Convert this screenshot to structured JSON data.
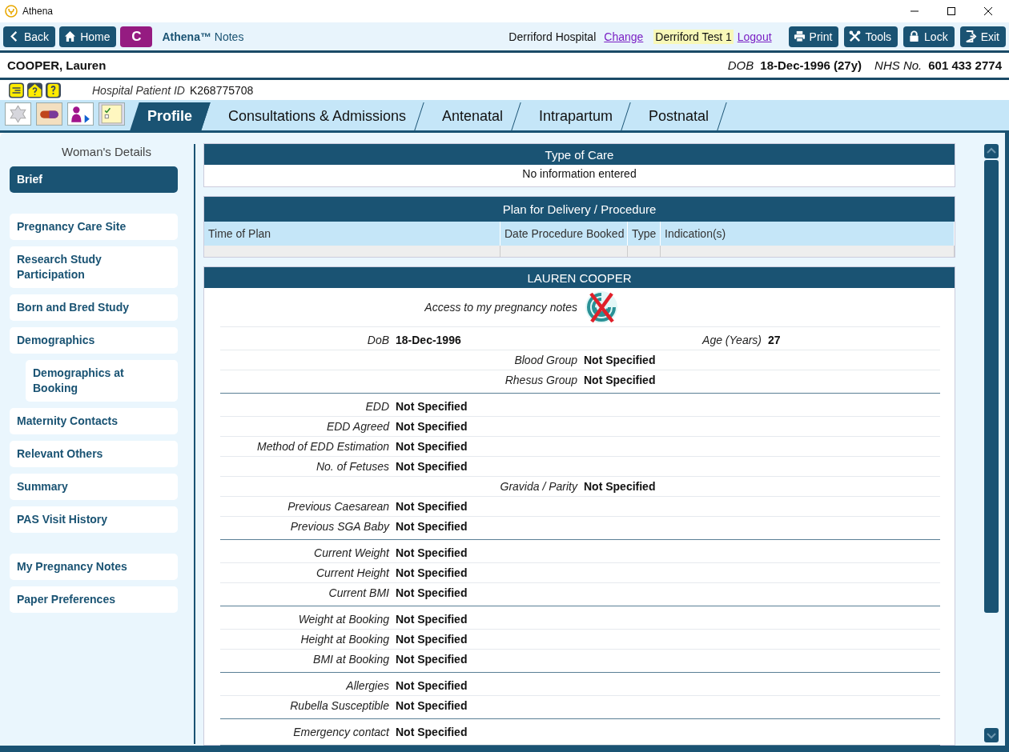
{
  "window": {
    "title": "Athena"
  },
  "toolbar": {
    "nav_buttons": [
      {
        "kind": "back",
        "label": "Back"
      },
      {
        "kind": "home",
        "label": "Home"
      },
      {
        "kind": "initial",
        "label": "C"
      }
    ],
    "app_name": "**Athena™** Notes",
    "location": "Derriford Hospital",
    "change_link": "Change",
    "user": "Derriford Test 1",
    "logout_link": "Logout",
    "actions": [
      {
        "kind": "print",
        "label": "Print"
      },
      {
        "kind": "tools",
        "label": "Tools"
      },
      {
        "kind": "lock",
        "label": "Lock"
      },
      {
        "kind": "exit",
        "label": "Exit"
      }
    ]
  },
  "patient": {
    "name": "COOPER, Lauren",
    "dob_label": "DOB",
    "dob": "18-Dec-1996 (27y)",
    "nhs_label": "NHS No.",
    "nhs": "601 433 2774",
    "id_label": "Hospital Patient ID",
    "id": "K268775708"
  },
  "tabs": [
    {
      "label": "Profile",
      "selected": true
    },
    {
      "label": "Consultations & Admissions",
      "selected": false
    },
    {
      "label": "Antenatal",
      "selected": false
    },
    {
      "label": "Intrapartum",
      "selected": false
    },
    {
      "label": "Postnatal",
      "selected": false
    }
  ],
  "sidebar": {
    "title": "Woman's Details",
    "groups": [
      {
        "items": [
          {
            "label": "Brief",
            "selected": true
          }
        ]
      },
      {
        "items": [
          {
            "label": "Pregnancy Care Site",
            "selected": false
          },
          {
            "label": "Research Study Participation",
            "selected": false
          },
          {
            "label": "Born and Bred Study",
            "selected": false
          },
          {
            "label": "Demographics",
            "selected": false,
            "children": [
              {
                "label": "Demographics at Booking",
                "selected": false
              }
            ]
          },
          {
            "label": "Maternity Contacts",
            "selected": false
          },
          {
            "label": "Relevant Others",
            "selected": false
          },
          {
            "label": "Summary",
            "selected": false
          },
          {
            "label": "PAS Visit History",
            "selected": false
          }
        ]
      },
      {
        "items": [
          {
            "label": "My Pregnancy Notes",
            "selected": false
          },
          {
            "label": "Paper Preferences",
            "selected": false
          }
        ]
      }
    ]
  },
  "type_of_care": {
    "title": "Type of Care",
    "message": "No information entered"
  },
  "plan": {
    "title": "Plan for Delivery / Procedure",
    "columns": [
      "Time of Plan",
      "Date Procedure Booked",
      "Type",
      "Indication(s)"
    ]
  },
  "profile": {
    "title": "LAUREN COOPER",
    "access_label": "Access to my pregnancy notes",
    "access_enabled": false,
    "groups": [
      {
        "rows": [
          {
            "kind": "pair",
            "fields": [
              {
                "label": "DoB",
                "value": "18-Dec-1996"
              },
              {
                "label": "Age (Years)",
                "value": "27"
              }
            ]
          },
          {
            "kind": "center",
            "fields": [
              {
                "label": "Blood Group",
                "value": "Not Specified"
              }
            ]
          },
          {
            "kind": "center",
            "fields": [
              {
                "label": "Rhesus Group",
                "value": "Not Specified"
              }
            ]
          }
        ]
      },
      {
        "rows": [
          {
            "kind": "left",
            "fields": [
              {
                "label": "EDD",
                "value": "Not Specified"
              }
            ]
          },
          {
            "kind": "left",
            "fields": [
              {
                "label": "EDD Agreed",
                "value": "Not Specified"
              }
            ]
          },
          {
            "kind": "left",
            "fields": [
              {
                "label": "Method of EDD Estimation",
                "value": "Not Specified"
              }
            ]
          },
          {
            "kind": "left",
            "fields": [
              {
                "label": "No. of Fetuses",
                "value": "Not Specified"
              }
            ]
          },
          {
            "kind": "center",
            "fields": [
              {
                "label": "Gravida / Parity",
                "value": "Not Specified"
              }
            ]
          },
          {
            "kind": "left",
            "fields": [
              {
                "label": "Previous Caesarean",
                "value": "Not Specified"
              }
            ]
          },
          {
            "kind": "left",
            "fields": [
              {
                "label": "Previous SGA Baby",
                "value": "Not Specified"
              }
            ]
          }
        ]
      },
      {
        "rows": [
          {
            "kind": "left",
            "fields": [
              {
                "label": "Current Weight",
                "value": "Not Specified"
              }
            ]
          },
          {
            "kind": "left",
            "fields": [
              {
                "label": "Current Height",
                "value": "Not Specified"
              }
            ]
          },
          {
            "kind": "left",
            "fields": [
              {
                "label": "Current BMI",
                "value": "Not Specified"
              }
            ]
          }
        ]
      },
      {
        "rows": [
          {
            "kind": "left",
            "fields": [
              {
                "label": "Weight at Booking",
                "value": "Not Specified"
              }
            ]
          },
          {
            "kind": "left",
            "fields": [
              {
                "label": "Height at Booking",
                "value": "Not Specified"
              }
            ]
          },
          {
            "kind": "left",
            "fields": [
              {
                "label": "BMI at Booking",
                "value": "Not Specified"
              }
            ]
          }
        ]
      },
      {
        "rows": [
          {
            "kind": "left",
            "fields": [
              {
                "label": "Allergies",
                "value": "Not Specified"
              }
            ]
          },
          {
            "kind": "left",
            "fields": [
              {
                "label": "Rubella Susceptible",
                "value": "Not Specified"
              }
            ]
          }
        ]
      },
      {
        "rows": [
          {
            "kind": "left",
            "fields": [
              {
                "label": "Emergency contact",
                "value": "Not Specified"
              }
            ]
          }
        ]
      }
    ]
  }
}
